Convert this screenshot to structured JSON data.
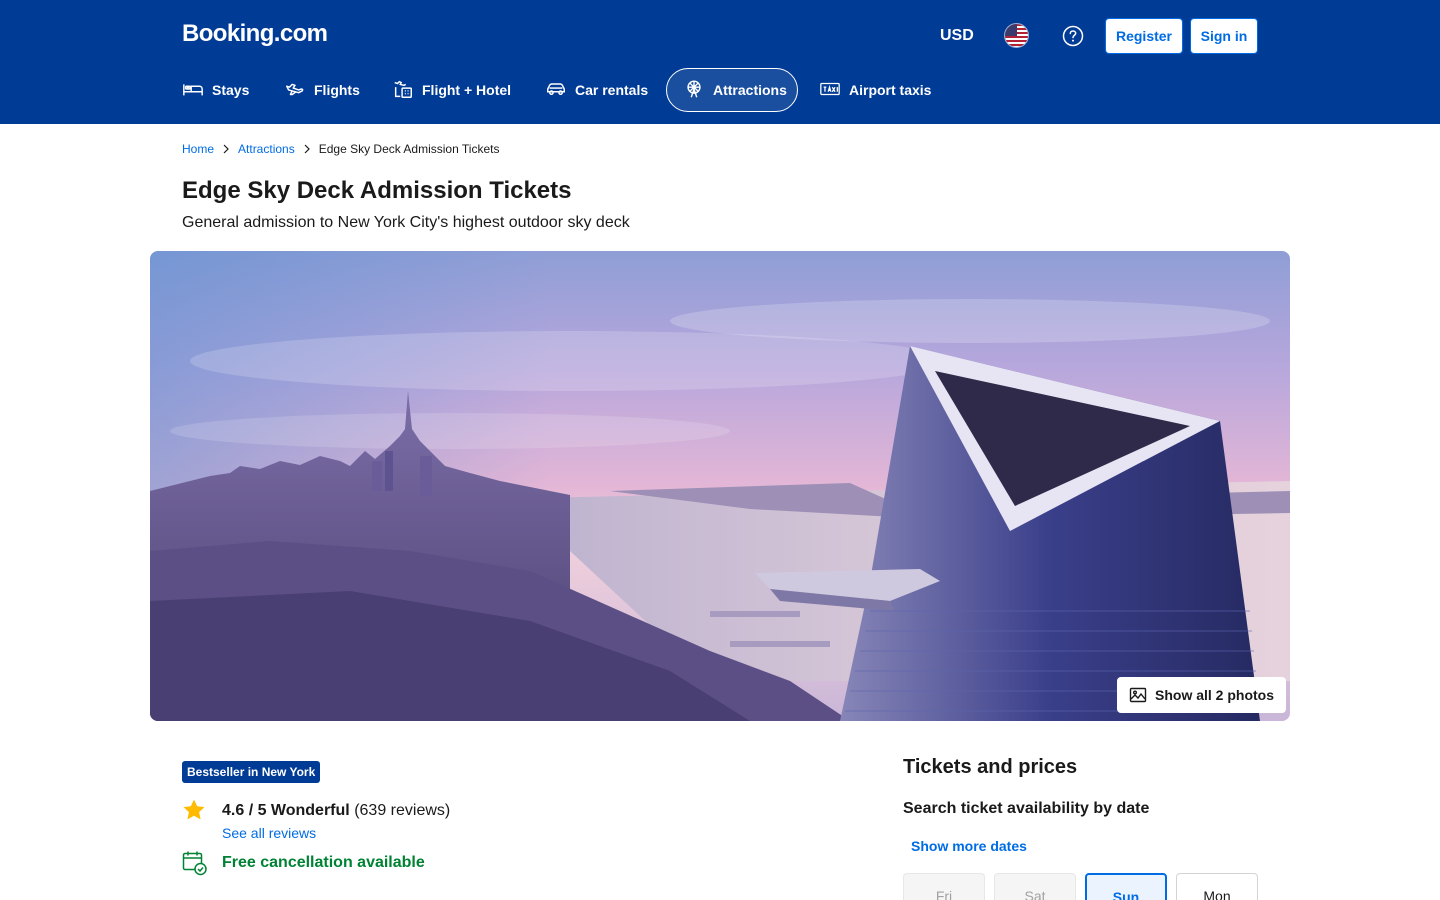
{
  "header": {
    "logo": "Booking.com",
    "currency": "USD",
    "register_label": "Register",
    "signin_label": "Sign in"
  },
  "nav": {
    "items": [
      {
        "label": "Stays",
        "icon": "bed-icon"
      },
      {
        "label": "Flights",
        "icon": "plane-icon"
      },
      {
        "label": "Flight + Hotel",
        "icon": "flight-hotel-icon"
      },
      {
        "label": "Car rentals",
        "icon": "car-icon"
      },
      {
        "label": "Attractions",
        "icon": "ferris-wheel-icon",
        "active": true
      },
      {
        "label": "Airport taxis",
        "icon": "taxi-icon"
      }
    ]
  },
  "breadcrumb": {
    "home": "Home",
    "attractions": "Attractions",
    "current": "Edge Sky Deck Admission Tickets"
  },
  "page": {
    "title": "Edge Sky Deck Admission Tickets",
    "subtitle": "General admission to New York City's highest outdoor sky deck",
    "show_photos": "Show all 2 photos"
  },
  "info": {
    "badge": "Bestseller in New York",
    "rating_score": "4.6 / 5 Wonderful",
    "rating_count": "(639 reviews)",
    "see_reviews": "See all reviews",
    "free_cancellation": "Free cancellation available"
  },
  "tickets": {
    "title": "Tickets and prices",
    "subtitle": "Search ticket availability by date",
    "show_more": "Show more dates",
    "days": [
      {
        "label": "Fri",
        "state": "disabled"
      },
      {
        "label": "Sat",
        "state": "disabled"
      },
      {
        "label": "Sun",
        "state": "selected"
      },
      {
        "label": "Mon",
        "state": "normal"
      }
    ]
  },
  "colors": {
    "brand_blue": "#003b95",
    "link_blue": "#006ce4",
    "success_green": "#008234",
    "star_yellow": "#febb02"
  }
}
